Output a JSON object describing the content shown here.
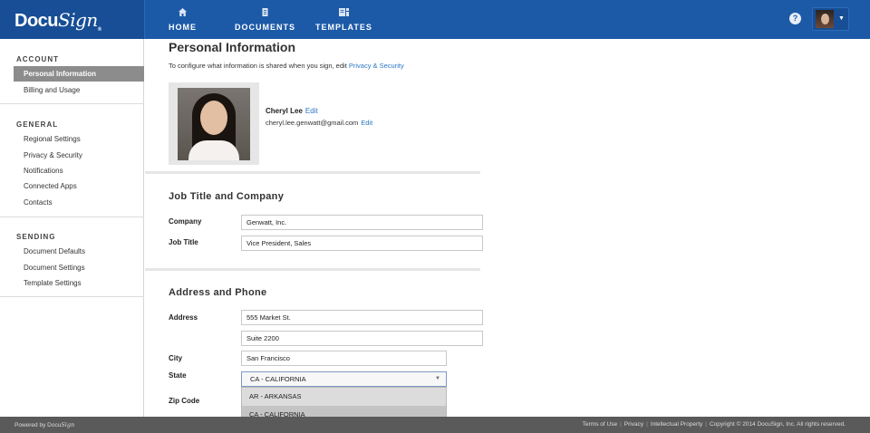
{
  "brand": {
    "logo_prefix": "Docu",
    "logo_suffix": "Sign",
    "logo_mark": "®"
  },
  "topnav": {
    "items": [
      {
        "label": "HOME",
        "icon": "home-icon"
      },
      {
        "label": "DOCUMENTS",
        "icon": "documents-icon"
      },
      {
        "label": "TEMPLATES",
        "icon": "templates-icon"
      }
    ],
    "help_label": "?"
  },
  "sidebar": {
    "sections": [
      {
        "heading": "ACCOUNT",
        "items": [
          "Personal Information",
          "Billing and Usage"
        ]
      },
      {
        "heading": "GENERAL",
        "items": [
          "Regional Settings",
          "Privacy & Security",
          "Notifications",
          "Connected Apps",
          "Contacts"
        ]
      },
      {
        "heading": "SENDING",
        "items": [
          "Document Defaults",
          "Document Settings",
          "Template Settings"
        ]
      }
    ],
    "active_item": "Personal Information"
  },
  "main": {
    "title": "Personal Information",
    "intro_text": "To configure what information is shared when you sign, edit ",
    "intro_link": "Privacy & Security",
    "profile": {
      "name": "Cheryl Lee",
      "email": "cheryl.lee.genwatt@gmail.com",
      "edit_label": "Edit"
    },
    "job": {
      "heading": "Job Title and Company",
      "company_label": "Company",
      "company_value": "Genwatt, Inc.",
      "title_label": "Job Title",
      "title_value": "Vice President, Sales"
    },
    "address": {
      "heading": "Address and Phone",
      "address_label": "Address",
      "address_line1": "555 Market St.",
      "address_line2": "Suite 2200",
      "city_label": "City",
      "city_value": "San Francisco",
      "state_label": "State",
      "state_value": "CA - CALIFORNIA",
      "state_options": [
        "AR - ARKANSAS",
        "CA - CALIFORNIA"
      ],
      "zip_label": "Zip Code"
    }
  },
  "footer": {
    "powered_by": "Powered by",
    "powered_brand_prefix": "Docu",
    "powered_brand_suffix": "Sign",
    "links": [
      "Terms of Use",
      "Privacy",
      "Intellectual Property"
    ],
    "copyright": "Copyright © 2014 DocuSign, Inc. All rights reserved."
  },
  "colors": {
    "topbar": "#1c5aa8",
    "link": "#2a76c6",
    "sidebar_active": "#8c8c8c",
    "footer": "#5a5a5a"
  }
}
